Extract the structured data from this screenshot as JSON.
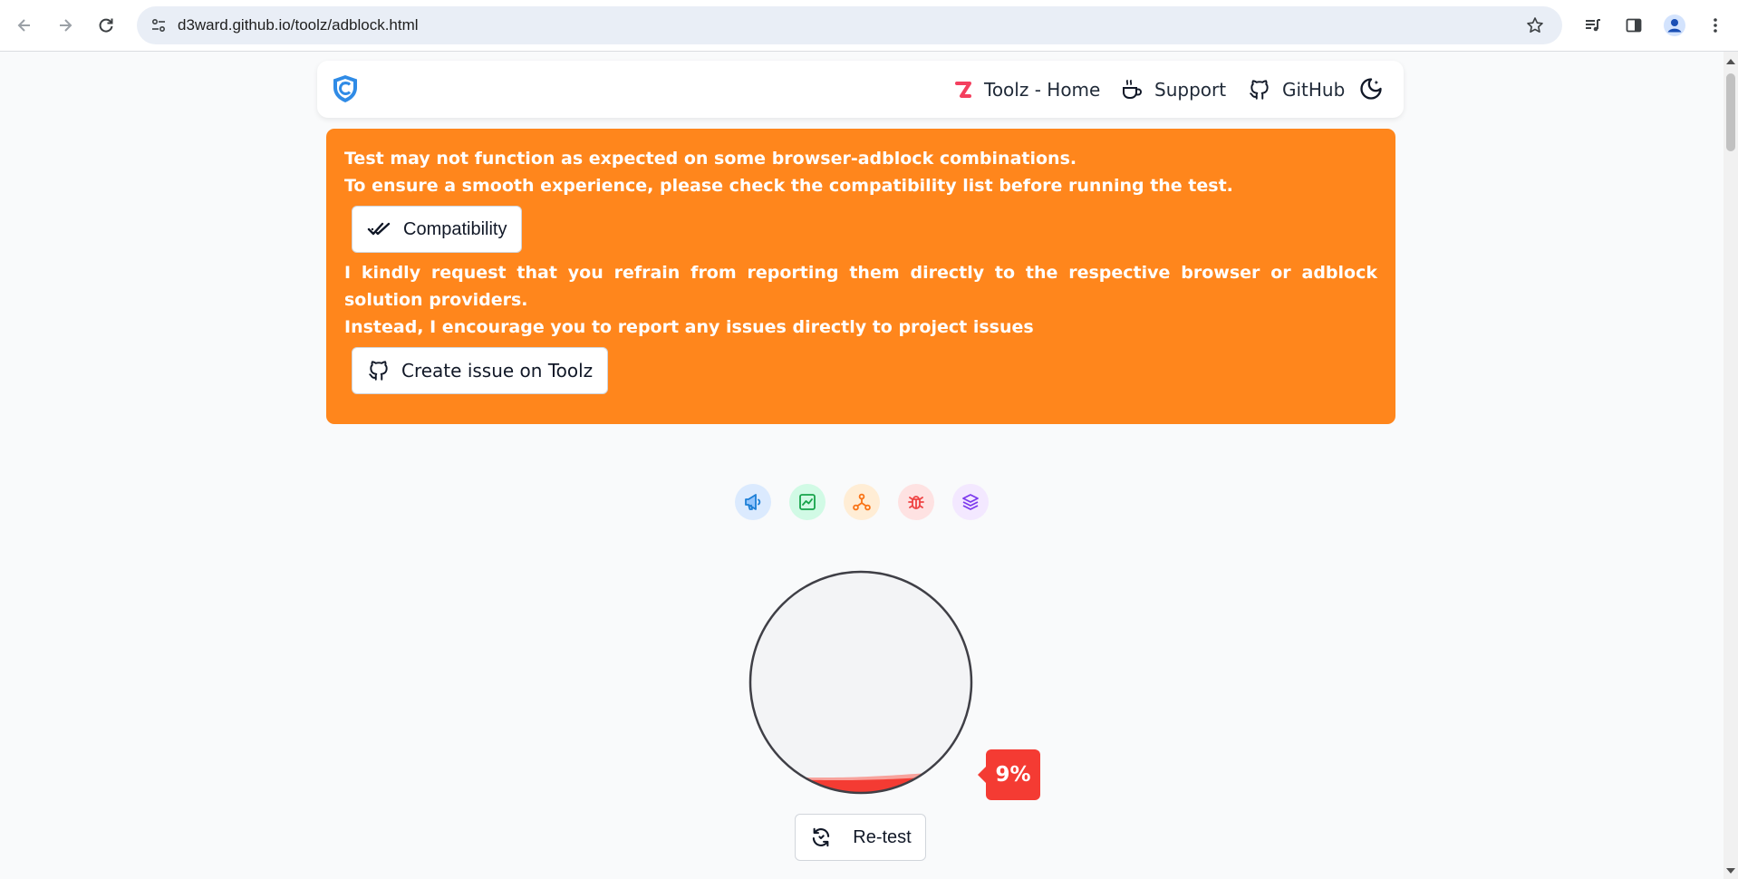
{
  "browser": {
    "url": "d3ward.github.io/toolz/adblock.html"
  },
  "navbar": {
    "links": [
      {
        "label": "Toolz - Home",
        "icon": "toolz-z-icon"
      },
      {
        "label": "Support",
        "icon": "coffee-cup-icon"
      },
      {
        "label": "GitHub",
        "icon": "github-icon"
      }
    ],
    "theme_icon": "moon-icon"
  },
  "alert": {
    "line1": "Test may not function as expected on some browser-adblock combinations.",
    "line2": "To ensure a smooth experience, please check the compatibility list before running the test.",
    "compat_button": "Compatibility",
    "line3": "I kindly request that you refrain from reporting them directly to the respective browser or adblock solution providers.",
    "line4": "Instead, I encourage you to report any issues directly to project issues",
    "issue_button": "Create issue on Toolz",
    "color": "#ff861c"
  },
  "categories": [
    {
      "name": "ads-megaphone-icon",
      "color": "#1d7fd6",
      "bg": "#dbeafe"
    },
    {
      "name": "analytics-chart-icon",
      "color": "#16a34a",
      "bg": "#d1fae5"
    },
    {
      "name": "error-monitoring-icon",
      "color": "#f97316",
      "bg": "#ffedd5"
    },
    {
      "name": "bug-icon",
      "color": "#ef4444",
      "bg": "#fee2e2"
    },
    {
      "name": "layers-icon",
      "color": "#7c3aed",
      "bg": "#f3e8ff"
    }
  ],
  "result": {
    "percent_label": "9%",
    "fill_fraction": 0.09,
    "fill_color": "#f43b33",
    "retest_label": "Re-test"
  }
}
